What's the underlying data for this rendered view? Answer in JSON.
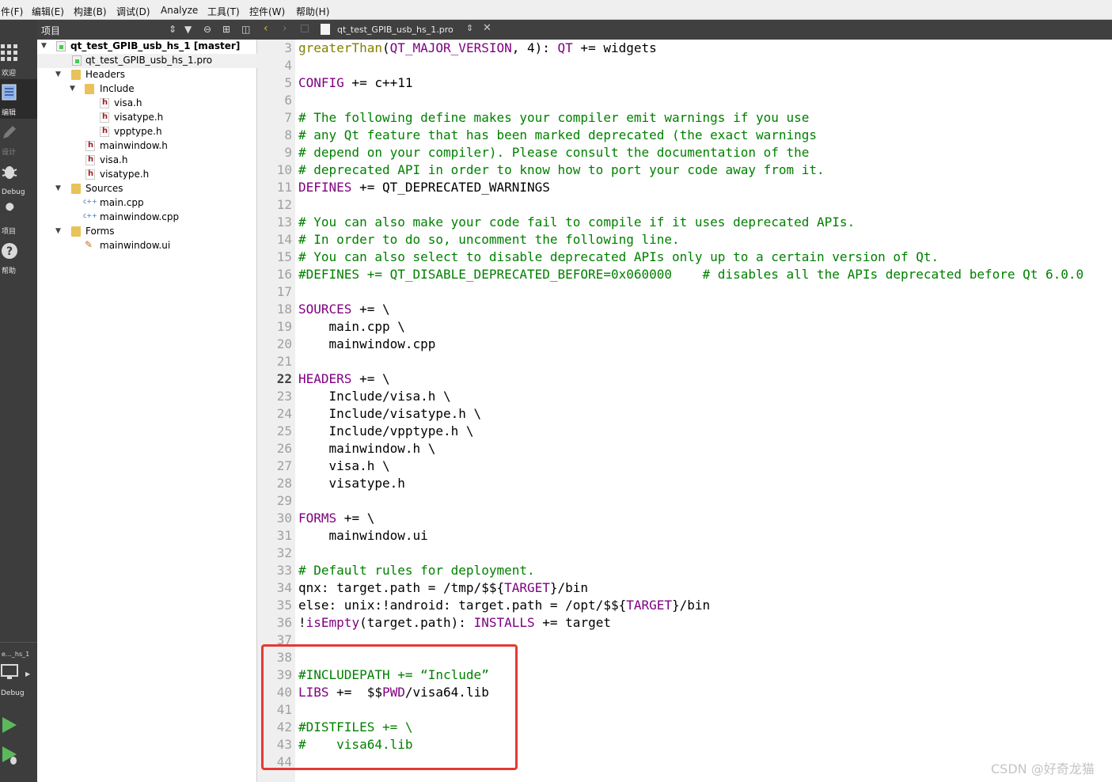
{
  "menu": {
    "items": [
      "件(F)",
      "编辑(E)",
      "构建(B)",
      "调试(D)",
      "Analyze",
      "工具(T)",
      "控件(W)",
      "帮助(H)"
    ]
  },
  "modebar": {
    "modes": [
      {
        "label": "欢迎",
        "icon": "grid-icon"
      },
      {
        "label": "编辑",
        "icon": "edit-doc-icon"
      },
      {
        "label": "设计",
        "icon": "pencil-icon"
      },
      {
        "label": "Debug",
        "icon": "bug-icon"
      },
      {
        "label": "项目",
        "icon": "wrench-icon"
      },
      {
        "label": "帮助",
        "icon": "help-icon"
      }
    ],
    "target_name": "e…_hs_1",
    "target_label": "Debug"
  },
  "project_pane": {
    "title": "项目",
    "tree": [
      {
        "text": "qt_test_GPIB_usb_hs_1 [master]",
        "icon": "pro-icon"
      },
      {
        "text": "qt_test_GPIB_usb_hs_1.pro",
        "icon": "pro-icon"
      },
      {
        "text": "Headers",
        "icon": "folder-icon"
      },
      {
        "text": "Include",
        "icon": "folder-icon"
      },
      {
        "text": "visa.h",
        "icon": "header-file-icon"
      },
      {
        "text": "visatype.h",
        "icon": "header-file-icon"
      },
      {
        "text": "vpptype.h",
        "icon": "header-file-icon"
      },
      {
        "text": "mainwindow.h",
        "icon": "header-file-icon"
      },
      {
        "text": "visa.h",
        "icon": "header-file-icon"
      },
      {
        "text": "visatype.h",
        "icon": "header-file-icon"
      },
      {
        "text": "Sources",
        "icon": "folder-icon"
      },
      {
        "text": "main.cpp",
        "icon": "cpp-file-icon"
      },
      {
        "text": "mainwindow.cpp",
        "icon": "cpp-file-icon"
      },
      {
        "text": "Forms",
        "icon": "folder-icon"
      },
      {
        "text": "mainwindow.ui",
        "icon": "ui-file-icon"
      }
    ]
  },
  "editor": {
    "file_name": "qt_test_GPIB_usb_hs_1.pro",
    "current_line": "22",
    "lines": [
      {
        "n": "3",
        "segs": [
          [
            "fn",
            "greaterThan"
          ],
          [
            "plain",
            "("
          ],
          [
            "kw",
            "QT_MAJOR_VERSION"
          ],
          [
            "plain",
            ", 4): "
          ],
          [
            "kw",
            "QT"
          ],
          [
            "plain",
            " += widgets"
          ]
        ]
      },
      {
        "n": "4",
        "segs": []
      },
      {
        "n": "5",
        "segs": [
          [
            "kw",
            "CONFIG"
          ],
          [
            "plain",
            " += c++11"
          ]
        ]
      },
      {
        "n": "6",
        "segs": []
      },
      {
        "n": "7",
        "segs": [
          [
            "com",
            "# The following define makes your compiler emit warnings if you use"
          ]
        ]
      },
      {
        "n": "8",
        "segs": [
          [
            "com",
            "# any Qt feature that has been marked deprecated (the exact warnings"
          ]
        ]
      },
      {
        "n": "9",
        "segs": [
          [
            "com",
            "# depend on your compiler). Please consult the documentation of the"
          ]
        ]
      },
      {
        "n": "10",
        "segs": [
          [
            "com",
            "# deprecated API in order to know how to port your code away from it."
          ]
        ]
      },
      {
        "n": "11",
        "segs": [
          [
            "kw",
            "DEFINES"
          ],
          [
            "plain",
            " += QT_DEPRECATED_WARNINGS"
          ]
        ]
      },
      {
        "n": "12",
        "segs": []
      },
      {
        "n": "13",
        "segs": [
          [
            "com",
            "# You can also make your code fail to compile if it uses deprecated APIs."
          ]
        ]
      },
      {
        "n": "14",
        "segs": [
          [
            "com",
            "# In order to do so, uncomment the following line."
          ]
        ]
      },
      {
        "n": "15",
        "segs": [
          [
            "com",
            "# You can also select to disable deprecated APIs only up to a certain version of Qt."
          ]
        ]
      },
      {
        "n": "16",
        "segs": [
          [
            "com",
            "#DEFINES += QT_DISABLE_DEPRECATED_BEFORE=0x060000    # disables all the APIs deprecated before Qt 6.0.0"
          ]
        ]
      },
      {
        "n": "17",
        "segs": []
      },
      {
        "n": "18",
        "segs": [
          [
            "kw",
            "SOURCES"
          ],
          [
            "plain",
            " += \\"
          ]
        ]
      },
      {
        "n": "19",
        "segs": [
          [
            "plain",
            "    main.cpp \\"
          ]
        ]
      },
      {
        "n": "20",
        "segs": [
          [
            "plain",
            "    mainwindow.cpp"
          ]
        ]
      },
      {
        "n": "21",
        "segs": []
      },
      {
        "n": "22",
        "segs": [
          [
            "kw",
            "HEADERS"
          ],
          [
            "plain",
            " += \\"
          ]
        ]
      },
      {
        "n": "23",
        "segs": [
          [
            "plain",
            "    Include/visa.h \\"
          ]
        ]
      },
      {
        "n": "24",
        "segs": [
          [
            "plain",
            "    Include/visatype.h \\"
          ]
        ]
      },
      {
        "n": "25",
        "segs": [
          [
            "plain",
            "    Include/vpptype.h \\"
          ]
        ]
      },
      {
        "n": "26",
        "segs": [
          [
            "plain",
            "    mainwindow.h \\"
          ]
        ]
      },
      {
        "n": "27",
        "segs": [
          [
            "plain",
            "    visa.h \\"
          ]
        ]
      },
      {
        "n": "28",
        "segs": [
          [
            "plain",
            "    visatype.h"
          ]
        ]
      },
      {
        "n": "29",
        "segs": []
      },
      {
        "n": "30",
        "segs": [
          [
            "kw",
            "FORMS"
          ],
          [
            "plain",
            " += \\"
          ]
        ]
      },
      {
        "n": "31",
        "segs": [
          [
            "plain",
            "    mainwindow.ui"
          ]
        ]
      },
      {
        "n": "32",
        "segs": []
      },
      {
        "n": "33",
        "segs": [
          [
            "com",
            "# Default rules for deployment."
          ]
        ]
      },
      {
        "n": "34",
        "segs": [
          [
            "plain",
            "qnx: target.path = /tmp/$${"
          ],
          [
            "kw",
            "TARGET"
          ],
          [
            "plain",
            "}/bin"
          ]
        ]
      },
      {
        "n": "35",
        "segs": [
          [
            "plain",
            "else: unix:!android: target.path = /opt/$${"
          ],
          [
            "kw",
            "TARGET"
          ],
          [
            "plain",
            "}/bin"
          ]
        ]
      },
      {
        "n": "36",
        "segs": [
          [
            "plain",
            "!"
          ],
          [
            "kw",
            "isEmpty"
          ],
          [
            "plain",
            "(target.path): "
          ],
          [
            "kw",
            "INSTALLS"
          ],
          [
            "plain",
            " += target"
          ]
        ]
      },
      {
        "n": "37",
        "segs": []
      },
      {
        "n": "38",
        "segs": []
      },
      {
        "n": "39",
        "segs": [
          [
            "com",
            "#INCLUDEPATH += “Include”"
          ]
        ]
      },
      {
        "n": "40",
        "segs": [
          [
            "kw",
            "LIBS"
          ],
          [
            "plain",
            " +=  $$"
          ],
          [
            "kw",
            "PWD"
          ],
          [
            "plain",
            "/visa64.lib"
          ]
        ]
      },
      {
        "n": "41",
        "segs": []
      },
      {
        "n": "42",
        "segs": [
          [
            "com",
            "#DISTFILES += \\"
          ]
        ]
      },
      {
        "n": "43",
        "segs": [
          [
            "com",
            "#    visa64.lib"
          ]
        ]
      },
      {
        "n": "44",
        "segs": []
      }
    ]
  },
  "watermark": "CSDN @好奇龙猫"
}
